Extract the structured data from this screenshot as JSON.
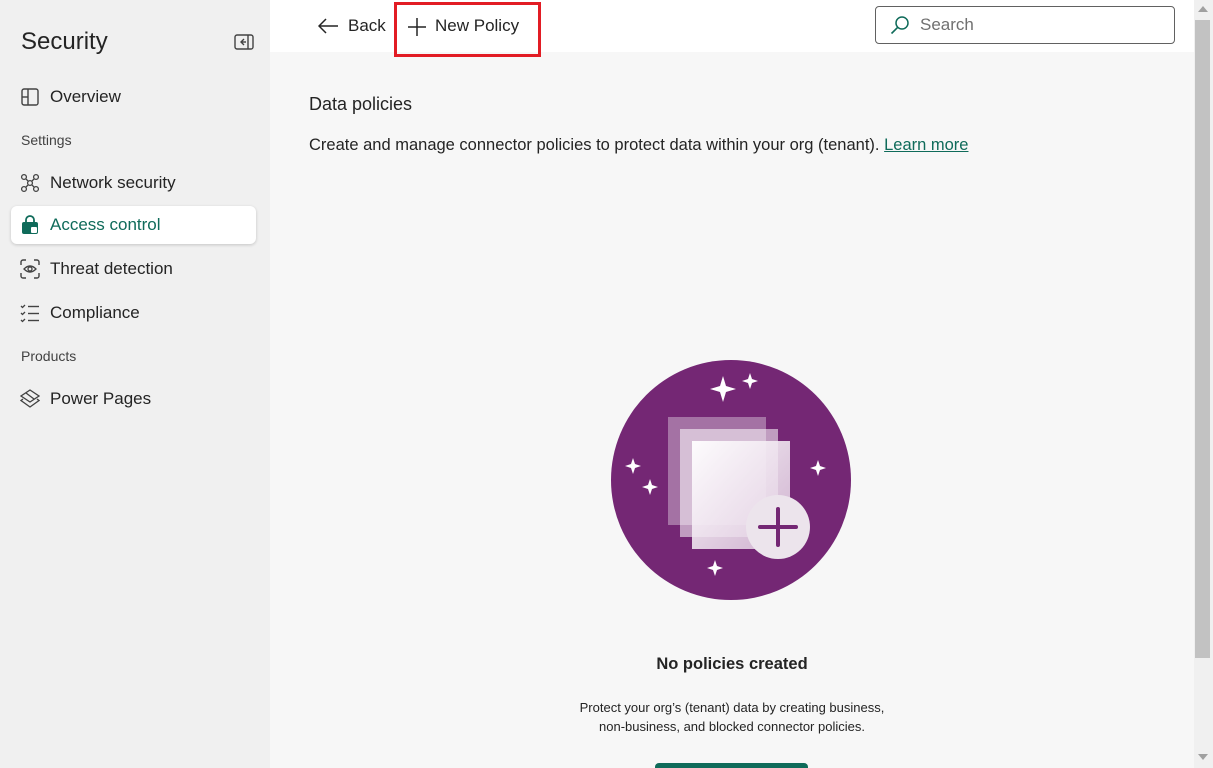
{
  "sidebar": {
    "title": "Security",
    "sections": {
      "settings": "Settings",
      "products": "Products"
    },
    "items": [
      {
        "label": "Overview",
        "icon": "overview-icon"
      },
      {
        "label": "Network security",
        "icon": "network-icon"
      },
      {
        "label": "Access control",
        "icon": "lock-bag-icon",
        "active": true
      },
      {
        "label": "Threat detection",
        "icon": "scan-eye-icon"
      },
      {
        "label": "Compliance",
        "icon": "checklist-icon"
      },
      {
        "label": "Power Pages",
        "icon": "power-pages-icon"
      }
    ]
  },
  "toolbar": {
    "back_label": "Back",
    "new_policy_label": "New Policy"
  },
  "search": {
    "placeholder": "Search"
  },
  "main": {
    "title": "Data policies",
    "description": "Create and manage connector policies to protect data within your org (tenant).",
    "learn_more": "Learn more",
    "empty_title": "No policies created",
    "empty_desc_line1": "Protect your org’s (tenant) data by creating business,",
    "empty_desc_line2": "non-business, and blocked connector policies."
  },
  "colors": {
    "accent": "#0f6b5a",
    "highlight": "#e21c24",
    "illustration": "#742774"
  }
}
